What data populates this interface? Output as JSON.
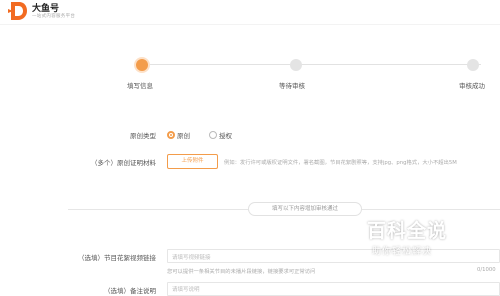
{
  "header": {
    "brand": "大鱼号",
    "slogan": "一站式内容服务平台"
  },
  "steps": [
    {
      "label": "填写信息",
      "active": true
    },
    {
      "label": "等待审核",
      "active": false
    },
    {
      "label": "审核成功",
      "active": false
    }
  ],
  "form": {
    "original_type": {
      "label": "原创类型",
      "options": [
        {
          "label": "原创",
          "checked": true
        },
        {
          "label": "授权",
          "checked": false
        }
      ]
    },
    "proof": {
      "label": "（多个）原创证明材料",
      "button": "上传附件",
      "hint": "例如：发行许可或版权证明文件，署名截图，节目花絮剧照等，支持jpg、png格式，大小不超出5M"
    },
    "divider_text": "填写以下内容增加审核通过",
    "trailer_link": {
      "label": "（选填）节目花絮视频链接",
      "placeholder": "请填写视频链接",
      "hint": "您可以提供一条相关节目的未播片段链接，链接要求可正常访问",
      "counter": "0/1000"
    },
    "remark": {
      "label": "（选填）备注说明",
      "placeholder": "请填写说明"
    }
  },
  "watermark": {
    "title": "百科全说",
    "subtitle": "助你轻松解决"
  },
  "colors": {
    "accent": "#f39c4a"
  }
}
